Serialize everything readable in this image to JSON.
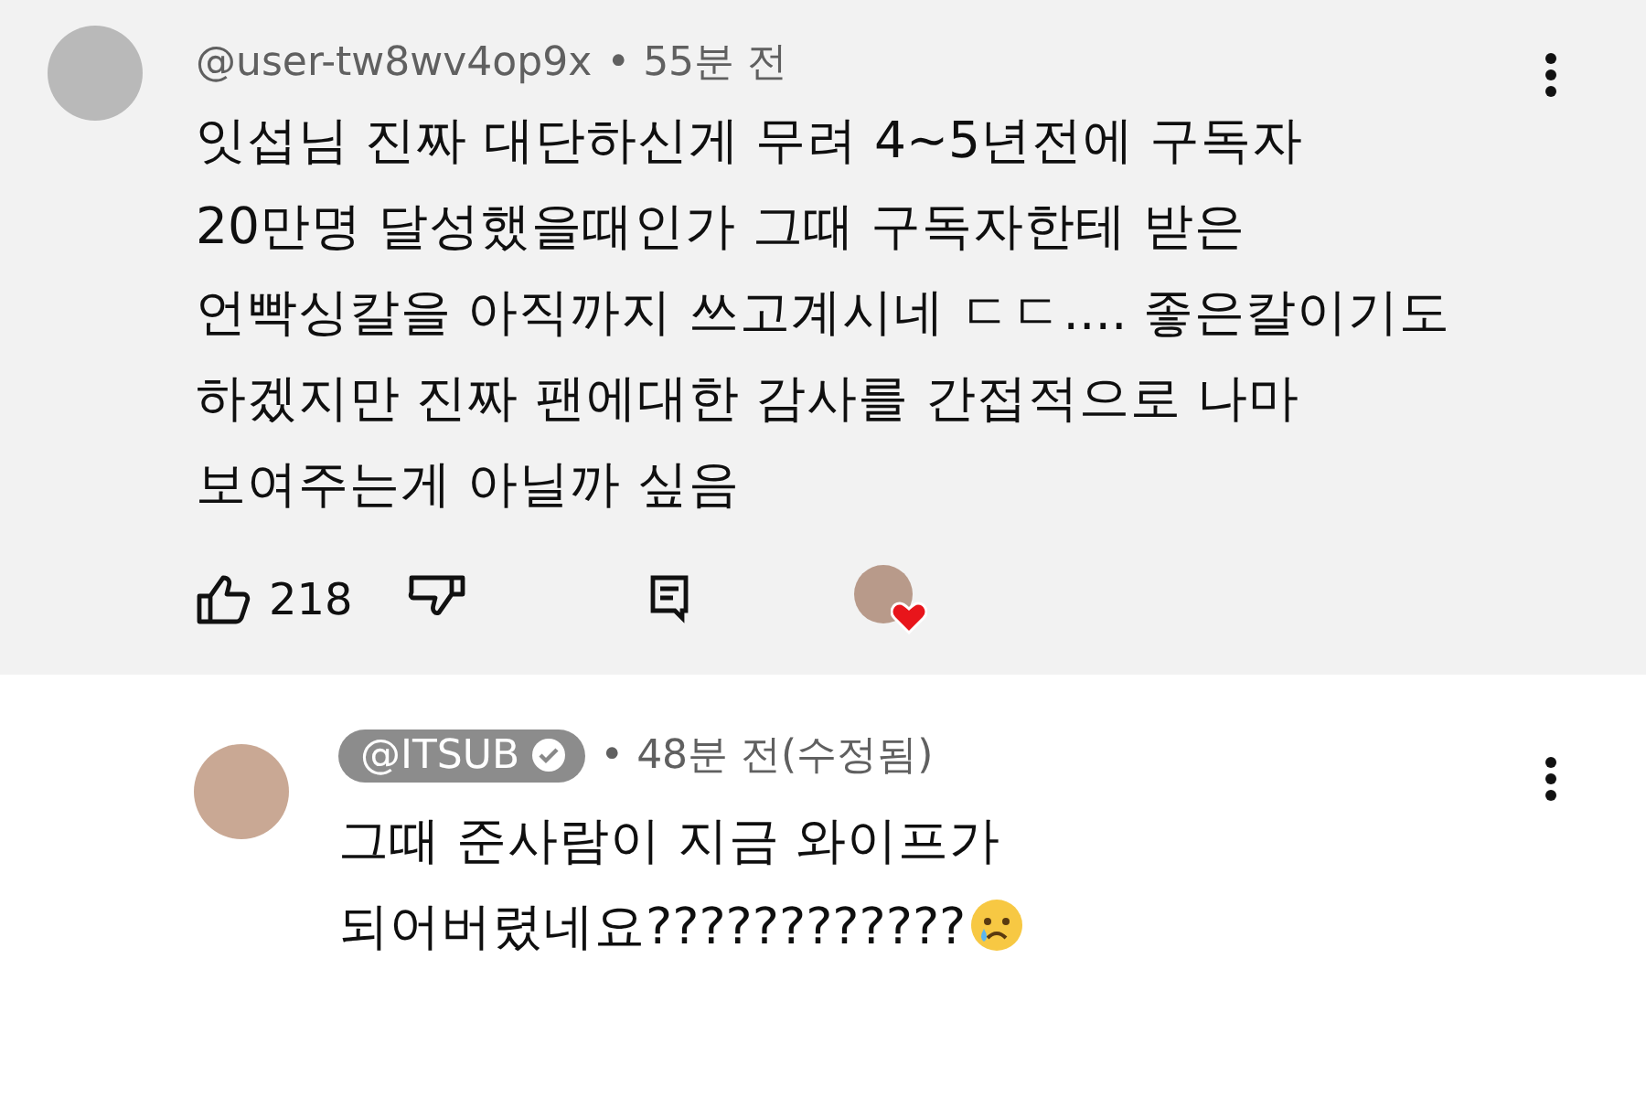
{
  "comment": {
    "author": "@user-tw8wv4op9x",
    "time": "• 55분 전",
    "text": "잇섭님 진짜 대단하신게 무려 4~5년전에 구독자\n20만명 달성했을때인가 그때 구독자한테 받은\n언빡싱칼을 아직까지 쓰고계시네 ㄷㄷ.... 좋은칼이기도\n하겠지만 진짜 팬에대한 감사를 간접적으로 나마\n보여주는게 아닐까 싶음",
    "likes": "218",
    "hearted": true
  },
  "reply": {
    "author": "@ITSUB",
    "verified": true,
    "time": "• 48분 전(수정됨)",
    "lines": [
      "그때 준사람이 지금 와이프가",
      "되어버렸네요????????????"
    ]
  }
}
